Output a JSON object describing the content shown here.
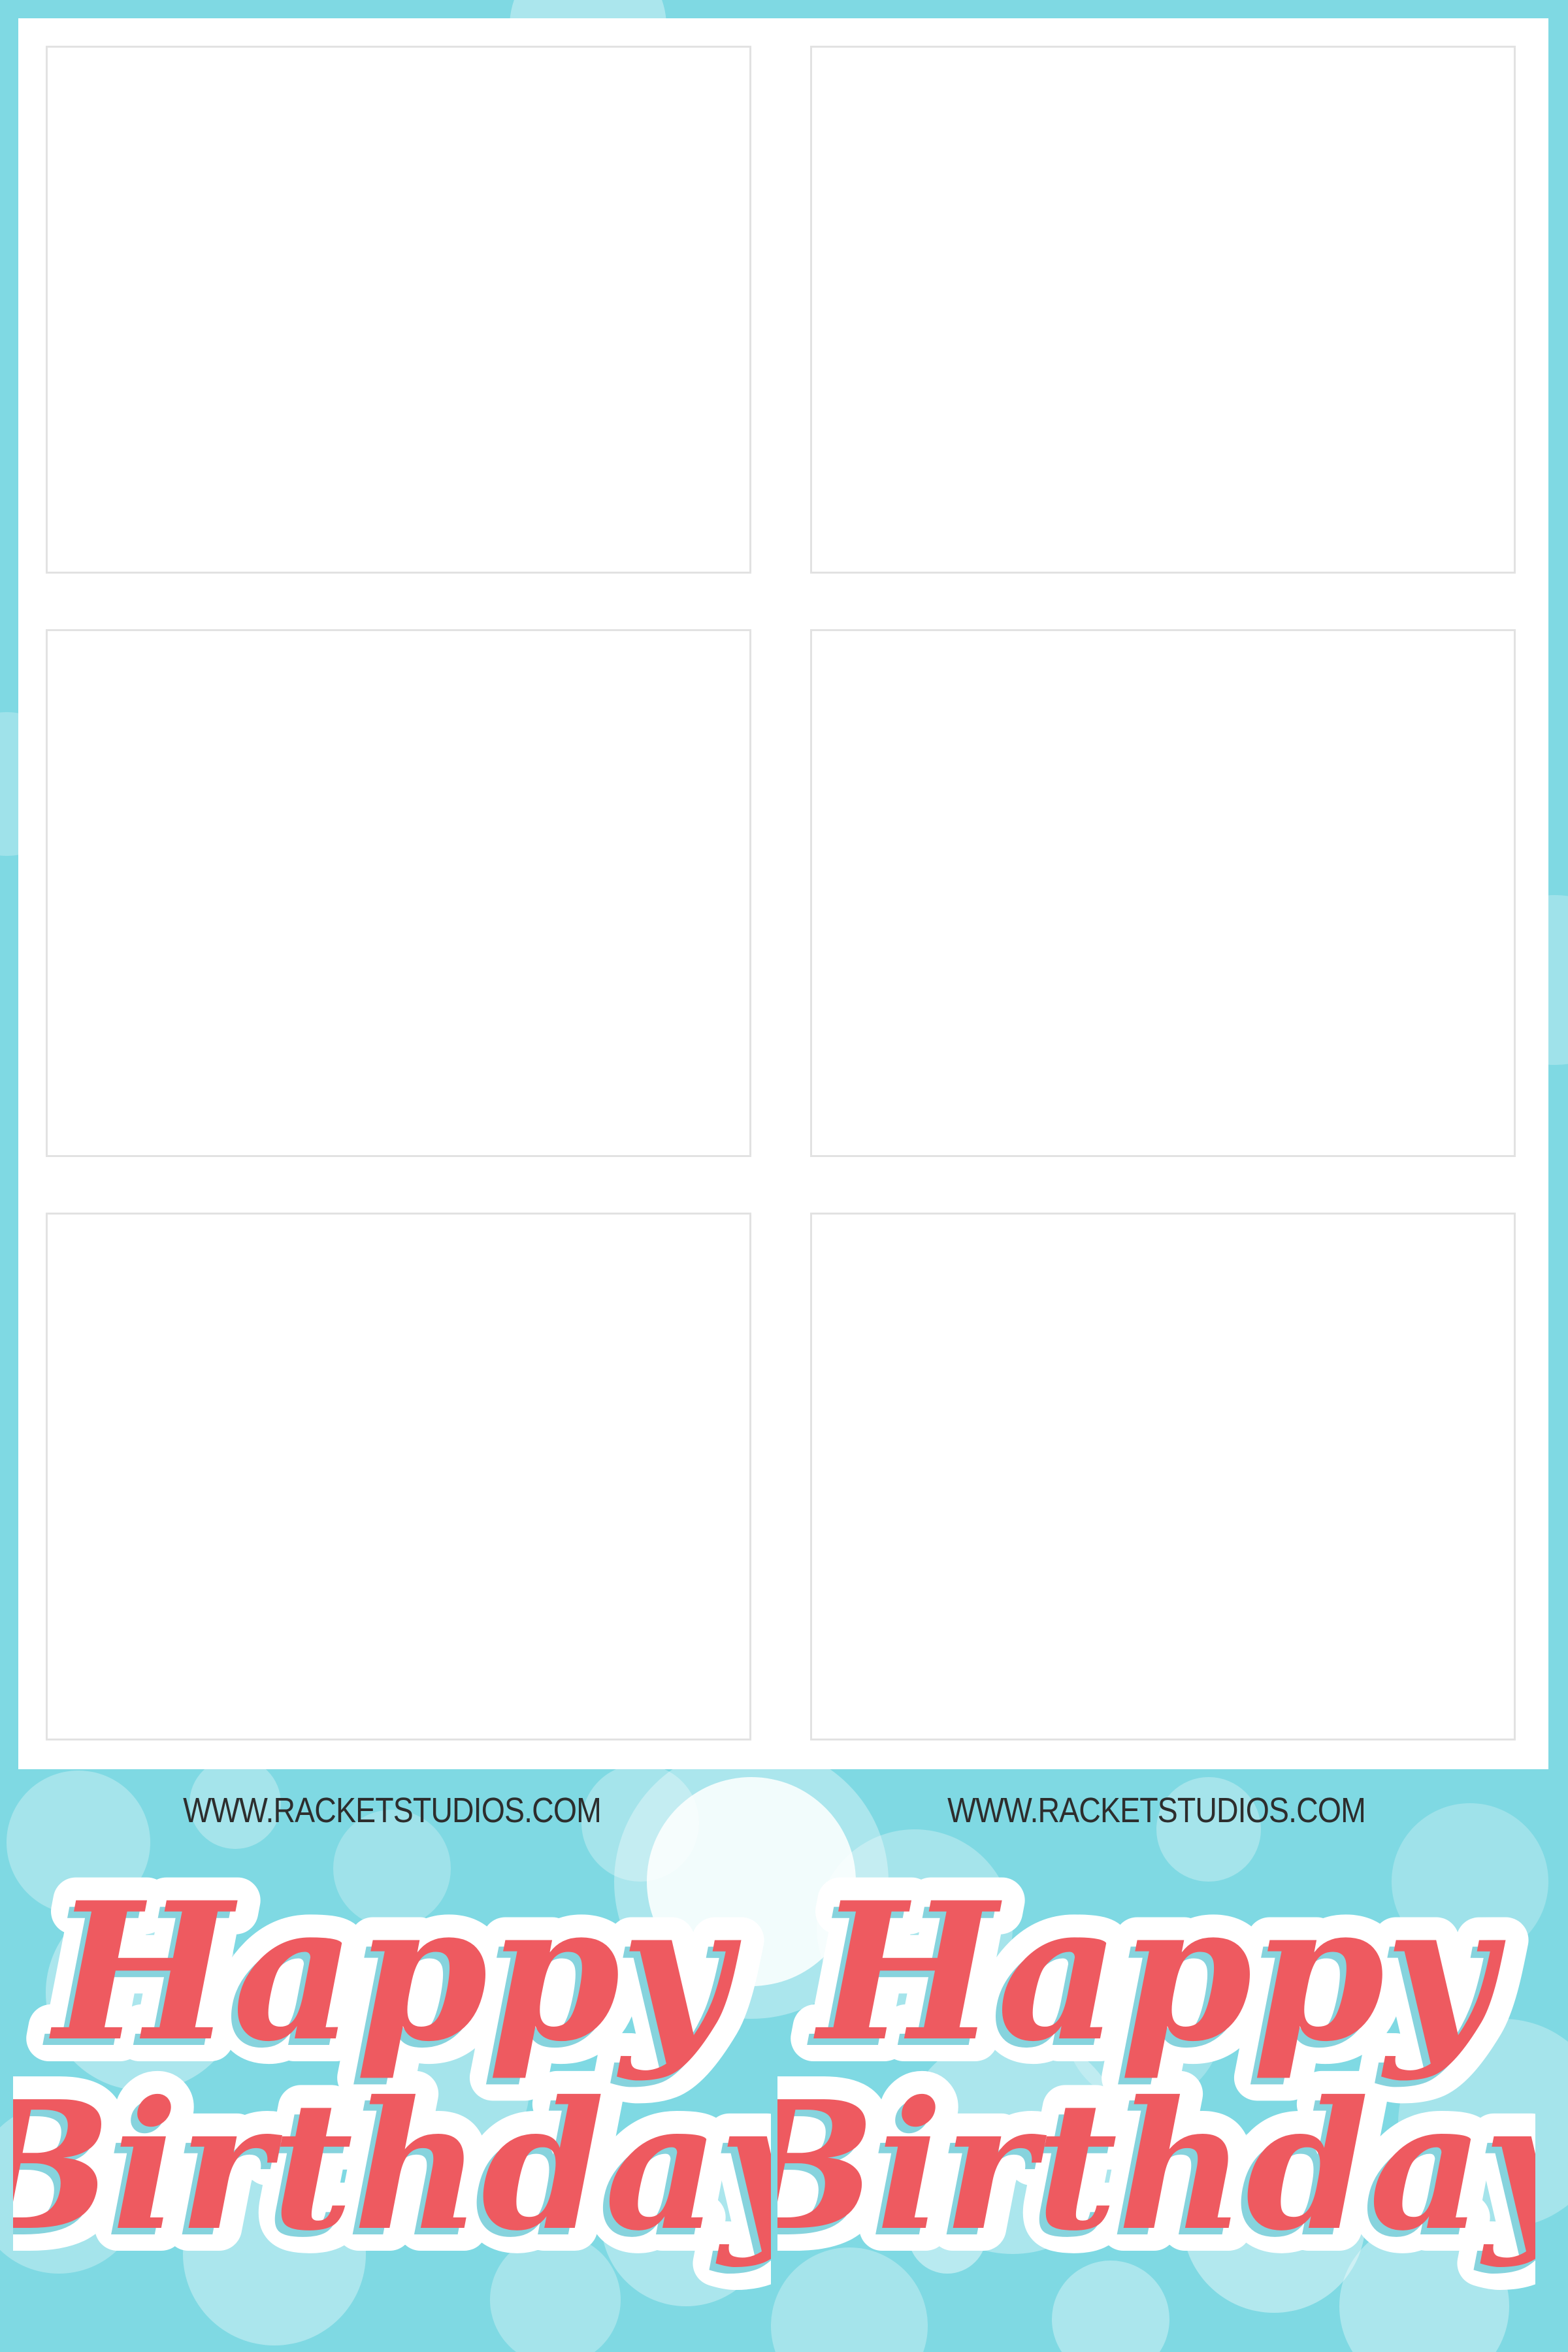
{
  "template": {
    "background_color": "#7fd9e3",
    "accent_color": "#ee5a60",
    "photo_slots": 6
  },
  "footer": {
    "website_left": "WWW.RACKETSTUDIOS.COM",
    "website_right": "WWW.RACKETSTUDIOS.COM",
    "greeting_left": {
      "line1": "Happy",
      "line2": "Birthday"
    },
    "greeting_right": {
      "line1": "Happy",
      "line2": "Birthday"
    }
  }
}
